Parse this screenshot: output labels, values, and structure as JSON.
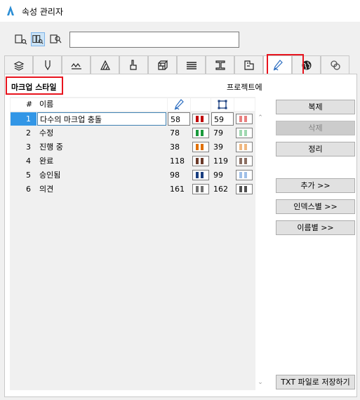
{
  "window": {
    "title": "속성 관리자"
  },
  "tabs": [
    {
      "name": "layers-tab",
      "icon": "layers-icon"
    },
    {
      "name": "pens-tab",
      "icon": "pen-icon"
    },
    {
      "name": "line-types-tab",
      "icon": "line-types-icon"
    },
    {
      "name": "fill-types-tab",
      "icon": "fill-types-icon"
    },
    {
      "name": "surfaces-tab",
      "icon": "paint-bucket-icon"
    },
    {
      "name": "building-materials-tab",
      "icon": "bricks-icon"
    },
    {
      "name": "composites-tab",
      "icon": "composite-layers-icon"
    },
    {
      "name": "profiles-tab",
      "icon": "i-beam-icon"
    },
    {
      "name": "zone-categories-tab",
      "icon": "zone-icon"
    },
    {
      "name": "markup-styles-tab",
      "icon": "markup-pen-icon"
    },
    {
      "name": "mep-systems-tab",
      "icon": "globe-icon"
    },
    {
      "name": "operation-profiles-tab",
      "icon": "operation-icon"
    }
  ],
  "section": {
    "title": "마크업 스타일",
    "project_label": "프로젝트에"
  },
  "table": {
    "headers": {
      "num": "#",
      "name": "이름"
    },
    "rows": [
      {
        "num": "1",
        "name": "다수의 마크업 충돌",
        "pen1": "58",
        "pen2": "59",
        "c1": "#c00000",
        "c2": "#e88080",
        "selected": true
      },
      {
        "num": "2",
        "name": "수정",
        "pen1": "78",
        "pen2": "79",
        "c1": "#1a9a3c",
        "c2": "#9fd8b0"
      },
      {
        "num": "3",
        "name": "진행 중",
        "pen1": "38",
        "pen2": "39",
        "c1": "#e07000",
        "c2": "#f0b880"
      },
      {
        "num": "4",
        "name": "완료",
        "pen1": "118",
        "pen2": "119",
        "c1": "#6b3a2a",
        "c2": "#8a6e62"
      },
      {
        "num": "5",
        "name": "승인됨",
        "pen1": "98",
        "pen2": "99",
        "c1": "#1a3f80",
        "c2": "#a0c0e8"
      },
      {
        "num": "6",
        "name": "의견",
        "pen1": "161",
        "pen2": "162",
        "c1": "#707070",
        "c2": "#505050"
      }
    ]
  },
  "buttons": {
    "duplicate": "복제",
    "delete": "삭제",
    "purge": "정리",
    "append": "추가 >>",
    "by_index": "인덱스별 >>",
    "by_name": "이름별 >>",
    "save_txt": "TXT 파일로 저장하기"
  },
  "search": {
    "value": ""
  }
}
